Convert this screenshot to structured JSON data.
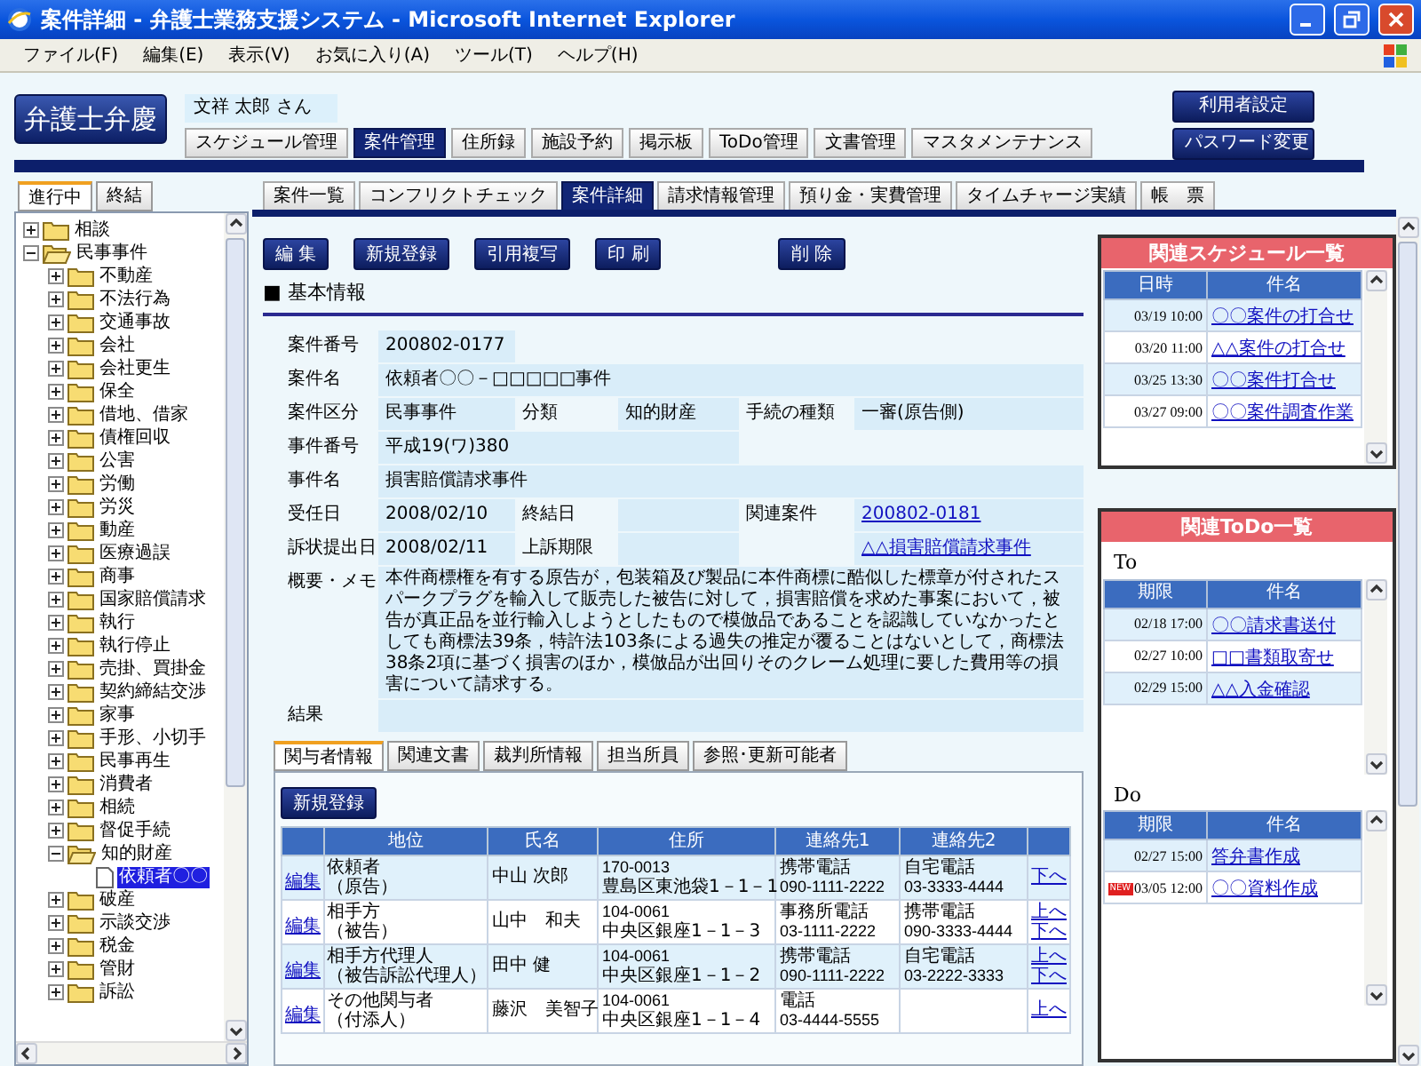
{
  "window": {
    "title": "案件詳細 - 弁護士業務支援システム - Microsoft Internet Explorer"
  },
  "menu": [
    "ファイル(F)",
    "編集(E)",
    "表示(V)",
    "お気に入り(A)",
    "ツール(T)",
    "ヘルプ(H)"
  ],
  "header": {
    "logo": "弁護士弁慶",
    "user": "文祥 太郎 さん",
    "nav": [
      {
        "label": "スケジュール管理",
        "selected": false
      },
      {
        "label": "案件管理",
        "selected": true
      },
      {
        "label": "住所録",
        "selected": false
      },
      {
        "label": "施設予約",
        "selected": false
      },
      {
        "label": "掲示板",
        "selected": false
      },
      {
        "label": "ToDo管理",
        "selected": false
      },
      {
        "label": "文書管理",
        "selected": false
      },
      {
        "label": "マスタメンテナンス",
        "selected": false
      }
    ],
    "buttons": [
      "利用者設定",
      "パスワード変更"
    ]
  },
  "left_panel": {
    "tabs": [
      {
        "label": "進行中",
        "selected": true
      },
      {
        "label": "終結",
        "selected": false
      }
    ],
    "tree": [
      {
        "kind": "folder",
        "label": "相談",
        "expanded": false,
        "selected": false
      },
      {
        "kind": "folder",
        "label": "民事事件",
        "expanded": true,
        "selected": false,
        "children": [
          {
            "kind": "folder",
            "label": "不動産",
            "expanded": false,
            "selected": false
          },
          {
            "kind": "folder",
            "label": "不法行為",
            "expanded": false,
            "selected": false
          },
          {
            "kind": "folder",
            "label": "交通事故",
            "expanded": false,
            "selected": false
          },
          {
            "kind": "folder",
            "label": "会社",
            "expanded": false,
            "selected": false
          },
          {
            "kind": "folder",
            "label": "会社更生",
            "expanded": false,
            "selected": false
          },
          {
            "kind": "folder",
            "label": "保全",
            "expanded": false,
            "selected": false
          },
          {
            "kind": "folder",
            "label": "借地、借家",
            "expanded": false,
            "selected": false
          },
          {
            "kind": "folder",
            "label": "債権回収",
            "expanded": false,
            "selected": false
          },
          {
            "kind": "folder",
            "label": "公害",
            "expanded": false,
            "selected": false
          },
          {
            "kind": "folder",
            "label": "労働",
            "expanded": false,
            "selected": false
          },
          {
            "kind": "folder",
            "label": "労災",
            "expanded": false,
            "selected": false
          },
          {
            "kind": "folder",
            "label": "動産",
            "expanded": false,
            "selected": false
          },
          {
            "kind": "folder",
            "label": "医療過誤",
            "expanded": false,
            "selected": false
          },
          {
            "kind": "folder",
            "label": "商事",
            "expanded": false,
            "selected": false
          },
          {
            "kind": "folder",
            "label": "国家賠償請求",
            "expanded": false,
            "selected": false
          },
          {
            "kind": "folder",
            "label": "執行",
            "expanded": false,
            "selected": false
          },
          {
            "kind": "folder",
            "label": "執行停止",
            "expanded": false,
            "selected": false
          },
          {
            "kind": "folder",
            "label": "売掛、買掛金",
            "expanded": false,
            "selected": false
          },
          {
            "kind": "folder",
            "label": "契約締結交渉",
            "expanded": false,
            "selected": false
          },
          {
            "kind": "folder",
            "label": "家事",
            "expanded": false,
            "selected": false
          },
          {
            "kind": "folder",
            "label": "手形、小切手",
            "expanded": false,
            "selected": false
          },
          {
            "kind": "folder",
            "label": "民事再生",
            "expanded": false,
            "selected": false
          },
          {
            "kind": "folder",
            "label": "消費者",
            "expanded": false,
            "selected": false
          },
          {
            "kind": "folder",
            "label": "相続",
            "expanded": false,
            "selected": false
          },
          {
            "kind": "folder",
            "label": "督促手続",
            "expanded": false,
            "selected": false
          },
          {
            "kind": "folder",
            "label": "知的財産",
            "expanded": true,
            "selected": false,
            "children": [
              {
                "kind": "document",
                "label": "依頼者〇〇",
                "selected": true
              }
            ]
          },
          {
            "kind": "folder",
            "label": "破産",
            "expanded": false,
            "selected": false
          },
          {
            "kind": "folder",
            "label": "示談交渉",
            "expanded": false,
            "selected": false
          },
          {
            "kind": "folder",
            "label": "税金",
            "expanded": false,
            "selected": false
          },
          {
            "kind": "folder",
            "label": "管財",
            "expanded": false,
            "selected": false
          },
          {
            "kind": "folder",
            "label": "訴訟",
            "expanded": false,
            "selected": false
          }
        ]
      }
    ]
  },
  "sub_tabs": [
    {
      "label": "案件一覧",
      "selected": false
    },
    {
      "label": "コンフリクトチェック",
      "selected": false
    },
    {
      "label": "案件詳細",
      "selected": true
    },
    {
      "label": "請求情報管理",
      "selected": false
    },
    {
      "label": "預り金・実費管理",
      "selected": false
    },
    {
      "label": "タイムチャージ実績",
      "selected": false
    },
    {
      "label": "帳　票",
      "selected": false
    }
  ],
  "toolbar": [
    "編 集",
    "新規登録",
    "引用複写",
    "印 刷",
    "削 除"
  ],
  "section_title": "■ 基本情報",
  "form": [
    {
      "kind": "narrow",
      "label": "案件番号",
      "value": "200802-0177"
    },
    {
      "kind": "wide",
      "label": "案件名",
      "value": "依頼者〇〇－□□□□□事件"
    },
    {
      "kind": "triple",
      "pairs": [
        {
          "label": "案件区分",
          "value": "民事事件",
          "link": false
        },
        {
          "label": "分類",
          "value": "知的財産",
          "link": false
        },
        {
          "label": "手続の種類",
          "value": "一審(原告側)",
          "link": false
        }
      ]
    },
    {
      "kind": "medium",
      "label": "事件番号",
      "value": "平成19(ワ)380"
    },
    {
      "kind": "wide",
      "label": "事件名",
      "value": "損害賠償請求事件"
    },
    {
      "kind": "triple",
      "pairs": [
        {
          "label": "受任日",
          "value": "2008/02/10",
          "link": false
        },
        {
          "label": "終結日"
        },
        {
          "label": "関連案件",
          "value": "200802-0181",
          "link": true
        }
      ]
    },
    {
      "kind": "triple",
      "pairs": [
        {
          "label": "訴状提出日",
          "value": "2008/02/11",
          "link": false
        },
        {
          "label": "上訴期限"
        },
        {
          "value": "△△損害賠償請求事件",
          "link": true
        }
      ]
    },
    {
      "kind": "memo",
      "label": "概要・メモ",
      "value": "本件商標権を有する原告が，包装箱及び製品に本件商標に酷似した標章が付されたスパークプラグを輸入して販売した被告に対して，損害賠償を求めた事案において，被告が真正品を並行輸入しようとしたもので模倣品であることを認識していなかったとしても商標法39条，特許法103条による過失の推定が覆ることはないとして，商標法38条2項に基づく損害のほか，模倣品が出回りそのクレーム処理に要した費用等の損害について請求する。"
    },
    {
      "kind": "wide",
      "label": "結果"
    }
  ],
  "detail_tabs": [
    {
      "label": "関与者情報",
      "selected": true
    },
    {
      "label": "関連文書",
      "selected": false
    },
    {
      "label": "裁判所情報",
      "selected": false
    },
    {
      "label": "担当所員",
      "selected": false
    },
    {
      "label": "参照･更新可能者",
      "selected": false
    }
  ],
  "parties": {
    "new_button": "新規登録",
    "columns": [
      "地位",
      "氏名",
      "住所",
      "連絡先1",
      "連絡先2"
    ],
    "rows": [
      {
        "action": "編集",
        "role": "依頼者",
        "role_note": "（原告）",
        "name": "中山 次郎",
        "postal": "170-0013",
        "address": "豊島区東池袋1－1－1",
        "contact1_type": "携帯電話",
        "contact1_phone": "090-1111-2222",
        "contact2_type": "自宅電話",
        "contact2_phone": "03-3333-4444",
        "moves": [
          "下へ"
        ]
      },
      {
        "action": "編集",
        "role": "相手方",
        "role_note": "（被告）",
        "name": "山中　和夫",
        "postal": "104-0061",
        "address": "中央区銀座1－1－3",
        "contact1_type": "事務所電話",
        "contact1_phone": "03-1111-2222",
        "contact2_type": "携帯電話",
        "contact2_phone": "090-3333-4444",
        "moves": [
          "上へ",
          "下へ"
        ]
      },
      {
        "action": "編集",
        "role": "相手方代理人",
        "role_note": "（被告訴訟代理人）",
        "name": "田中 健",
        "postal": "104-0061",
        "address": "中央区銀座1－1－2",
        "contact1_type": "携帯電話",
        "contact1_phone": "090-1111-2222",
        "contact2_type": "自宅電話",
        "contact2_phone": "03-2222-3333",
        "moves": [
          "上へ",
          "下へ"
        ]
      },
      {
        "action": "編集",
        "role": "その他関与者",
        "role_note": "（付添人）",
        "name": "藤沢　美智子",
        "postal": "104-0061",
        "address": "中央区銀座1－1－4",
        "contact1_type": "電話",
        "contact1_phone": "03-4444-5555",
        "moves": [
          "上へ"
        ]
      }
    ]
  },
  "schedule": {
    "title": "関連スケジュール一覧",
    "columns": [
      "日時",
      "件名"
    ],
    "rows": [
      {
        "time": "03/19 10:00",
        "subject": "〇〇案件の打合せ"
      },
      {
        "time": "03/20 11:00",
        "subject": "△△案件の打合せ"
      },
      {
        "time": "03/25 13:30",
        "subject": "〇〇案件打合せ"
      },
      {
        "time": "03/27 09:00",
        "subject": "〇〇案件調査作業"
      }
    ]
  },
  "todo": {
    "title": "関連ToDo一覧",
    "groups": [
      {
        "label": "To",
        "columns": [
          "期限",
          "件名"
        ],
        "rows": [
          {
            "time": "02/18 17:00",
            "subject": "〇〇請求書送付"
          },
          {
            "time": "02/27 10:00",
            "subject": "□□書類取寄せ"
          },
          {
            "time": "02/29 15:00",
            "subject": "△△入金確認"
          }
        ]
      },
      {
        "label": "Do",
        "columns": [
          "期限",
          "件名"
        ],
        "rows": [
          {
            "time": "02/27 15:00",
            "subject": "答弁書作成"
          },
          {
            "badge": "NEW",
            "time": "03/05 12:00",
            "subject": "〇〇資料作成"
          }
        ]
      }
    ]
  }
}
